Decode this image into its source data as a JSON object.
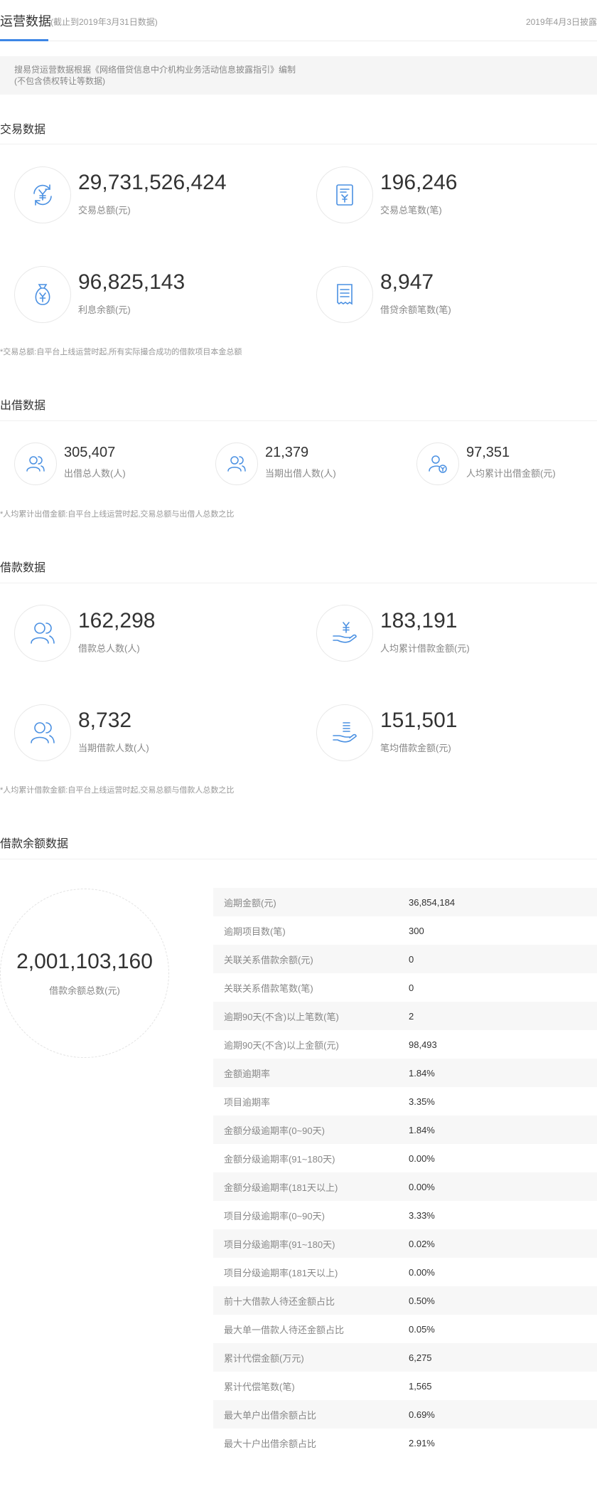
{
  "header": {
    "title": "运营数据",
    "subtitle": "(截止到2019年3月31日数据)",
    "disclose_date": "2019年4月3日披露"
  },
  "notice": {
    "line1": "搜易贷运营数据根据《网络借贷信息中介机构业务活动信息披露指引》编制",
    "line2": "(不包含债权转让等数据)"
  },
  "colors": {
    "accent": "#3d86e6",
    "icon_blue": "#4a90e2"
  },
  "trade": {
    "title": "交易数据",
    "items": [
      {
        "value": "29,731,526,424",
        "label": "交易总额(元)",
        "icon": "exchange-yuan-icon"
      },
      {
        "value": "196,246",
        "label": "交易总笔数(笔)",
        "icon": "document-yuan-icon"
      },
      {
        "value": "96,825,143",
        "label": "利息余额(元)",
        "icon": "money-bag-icon"
      },
      {
        "value": "8,947",
        "label": "借贷余额笔数(笔)",
        "icon": "receipt-icon"
      }
    ],
    "note": "*交易总额:自平台上线运营时起,所有实际撮合成功的借款项目本金总额"
  },
  "lend": {
    "title": "出借数据",
    "items": [
      {
        "value": "305,407",
        "label": "出借总人数(人)",
        "icon": "users-icon"
      },
      {
        "value": "21,379",
        "label": "当期出借人数(人)",
        "icon": "users-icon"
      },
      {
        "value": "97,351",
        "label": "人均累计出借金额(元)",
        "icon": "user-yuan-icon"
      }
    ],
    "note": "*人均累计出借金额:自平台上线运营时起,交易总额与出借人总数之比"
  },
  "borrow": {
    "title": "借款数据",
    "items": [
      {
        "value": "162,298",
        "label": "借款总人数(人)",
        "icon": "users-icon"
      },
      {
        "value": "183,191",
        "label": "人均累计借款金额(元)",
        "icon": "hand-yuan-icon"
      },
      {
        "value": "8,732",
        "label": "当期借款人数(人)",
        "icon": "users-icon"
      },
      {
        "value": "151,501",
        "label": "笔均借款金额(元)",
        "icon": "hand-coins-icon"
      }
    ],
    "note": "*人均累计借款金额:自平台上线运营时起,交易总额与借款人总数之比"
  },
  "balance": {
    "title": "借款余额数据",
    "total_value": "2,001,103,160",
    "total_label": "借款余额总数(元)",
    "rows": [
      {
        "k": "逾期金额(元)",
        "v": "36,854,184"
      },
      {
        "k": "逾期项目数(笔)",
        "v": "300"
      },
      {
        "k": "关联关系借款余额(元)",
        "v": "0"
      },
      {
        "k": "关联关系借款笔数(笔)",
        "v": "0"
      },
      {
        "k": "逾期90天(不含)以上笔数(笔)",
        "v": "2"
      },
      {
        "k": "逾期90天(不含)以上金额(元)",
        "v": "98,493"
      },
      {
        "k": "金额逾期率",
        "v": "1.84%"
      },
      {
        "k": "项目逾期率",
        "v": "3.35%"
      },
      {
        "k": "金额分级逾期率(0~90天)",
        "v": "1.84%"
      },
      {
        "k": "金额分级逾期率(91~180天)",
        "v": "0.00%"
      },
      {
        "k": "金额分级逾期率(181天以上)",
        "v": "0.00%"
      },
      {
        "k": "项目分级逾期率(0~90天)",
        "v": "3.33%"
      },
      {
        "k": "项目分级逾期率(91~180天)",
        "v": "0.02%"
      },
      {
        "k": "项目分级逾期率(181天以上)",
        "v": "0.00%"
      },
      {
        "k": "前十大借款人待还金额占比",
        "v": "0.50%"
      },
      {
        "k": "最大单一借款人待还金额占比",
        "v": "0.05%"
      },
      {
        "k": "累计代偿金额(万元)",
        "v": "6,275"
      },
      {
        "k": "累计代偿笔数(笔)",
        "v": "1,565"
      },
      {
        "k": "最大单户出借余额占比",
        "v": "0.69%"
      },
      {
        "k": "最大十户出借余额占比",
        "v": "2.91%"
      }
    ]
  }
}
